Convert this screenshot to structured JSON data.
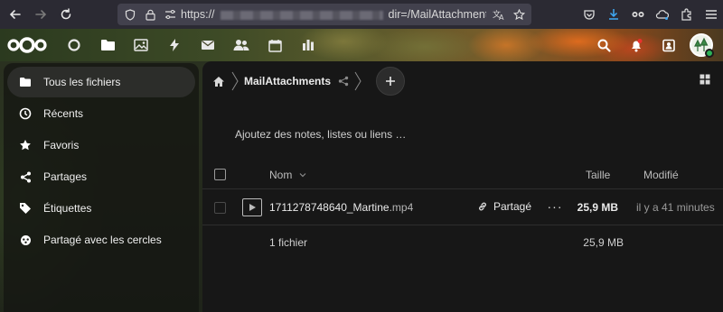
{
  "browser": {
    "url_prefix": "https://",
    "url_visible": "dir=/MailAttachments&fi"
  },
  "sidebar": {
    "items": [
      {
        "label": "Tous les fichiers",
        "icon": "folder-icon",
        "active": true
      },
      {
        "label": "Récents",
        "icon": "clock-icon"
      },
      {
        "label": "Favoris",
        "icon": "star-icon"
      },
      {
        "label": "Partages",
        "icon": "share-icon"
      },
      {
        "label": "Étiquettes",
        "icon": "tag-icon"
      },
      {
        "label": "Partagé avec les cercles",
        "icon": "circles-icon"
      }
    ]
  },
  "breadcrumb": {
    "current": "MailAttachments"
  },
  "notes_hint": "Ajoutez des notes, listes ou liens …",
  "table": {
    "headers": {
      "name": "Nom",
      "size": "Taille",
      "modified": "Modifié"
    },
    "rows": [
      {
        "name": "1711278748640_Martine",
        "ext": ".mp4",
        "share_label": "Partagé",
        "size": "25,9 MB",
        "modified": "il y a 41 minutes"
      }
    ],
    "summary": {
      "count": "1 fichier",
      "size": "25,9 MB"
    }
  },
  "colors": {
    "accent": "#2cb256",
    "background": "#171717"
  }
}
